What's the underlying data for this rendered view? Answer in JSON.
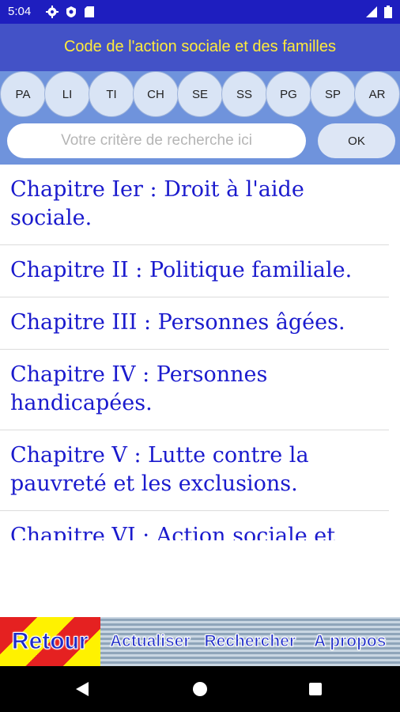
{
  "status_bar": {
    "time": "5:04"
  },
  "app_bar": {
    "title": "Code de l'action sociale et des familles"
  },
  "chips": [
    {
      "label": "PA"
    },
    {
      "label": "LI"
    },
    {
      "label": "TI"
    },
    {
      "label": "CH"
    },
    {
      "label": "SE"
    },
    {
      "label": "SS"
    },
    {
      "label": "PG"
    },
    {
      "label": "SP"
    },
    {
      "label": "AR"
    }
  ],
  "search": {
    "placeholder": "Votre critère de recherche ici",
    "button": "OK"
  },
  "list": [
    {
      "label": "Chapitre Ier : Droit à l'aide sociale."
    },
    {
      "label": "Chapitre II : Politique familiale."
    },
    {
      "label": "Chapitre III : Personnes âgées."
    },
    {
      "label": "Chapitre IV : Personnes handicapées."
    },
    {
      "label": "Chapitre V : Lutte contre la pauvreté et les exclusions."
    },
    {
      "label": "Chapitre VI : Action sociale et"
    }
  ],
  "bottom_nav": {
    "retour": "Retour",
    "actualiser": "Actualiser",
    "rechercher": "Rechercher",
    "apropos": "A propos"
  },
  "colors": {
    "status_bar": "#1e1ebf",
    "app_bar": "#4352c7",
    "title": "#ffeb3b",
    "chips_area": "#6f93dc",
    "list_text": "#1a1acd"
  },
  "icons": [
    "settings-icon",
    "shield-icon",
    "sd-card-icon",
    "signal-icon",
    "battery-icon",
    "back-icon",
    "home-icon",
    "recents-icon"
  ]
}
